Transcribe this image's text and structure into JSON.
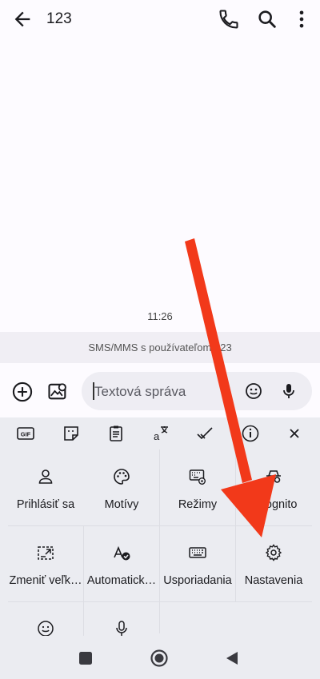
{
  "header": {
    "title": "123",
    "back_icon": "arrow-left-icon",
    "call_icon": "phone-icon",
    "search_icon": "search-icon",
    "menu_icon": "more-vert-icon"
  },
  "conversation": {
    "timestamp": "11:26",
    "sms_label": "SMS/MMS s používateľom 123"
  },
  "compose": {
    "placeholder": "Textová správa",
    "add_icon": "add-circle-icon",
    "gallery_icon": "gallery-icon",
    "emoji_icon": "emoji-icon",
    "mic_icon": "mic-icon"
  },
  "keyboard": {
    "toolbar": [
      {
        "name": "gif",
        "text": "GIF"
      },
      {
        "name": "sticker"
      },
      {
        "name": "clipboard"
      },
      {
        "name": "translate"
      },
      {
        "name": "spellcheck"
      },
      {
        "name": "info"
      },
      {
        "name": "close"
      }
    ],
    "tiles": [
      {
        "label": "Prihlásiť sa",
        "icon": "person-icon"
      },
      {
        "label": "Motívy",
        "icon": "palette-icon"
      },
      {
        "label": "Režimy",
        "icon": "keyboard-settings-icon"
      },
      {
        "label": "Inkognito",
        "icon": "incognito-icon"
      },
      {
        "label": "Zmeniť veľk…",
        "icon": "resize-icon"
      },
      {
        "label": "Automatick…",
        "icon": "autocorrect-icon"
      },
      {
        "label": "Usporiadania",
        "icon": "keyboard-icon"
      },
      {
        "label": "Nastavenia",
        "icon": "gear-icon"
      },
      {
        "label": "",
        "icon": "emoji-icon"
      },
      {
        "label": "",
        "icon": "mic-icon"
      }
    ]
  },
  "navbar": {
    "recents_icon": "square-icon",
    "home_icon": "circle-icon",
    "back_icon": "triangle-back-icon"
  },
  "colors": {
    "arrow": "#f2391a",
    "keyboard_bg": "#ebecf1",
    "band_bg": "#f0eef4"
  }
}
